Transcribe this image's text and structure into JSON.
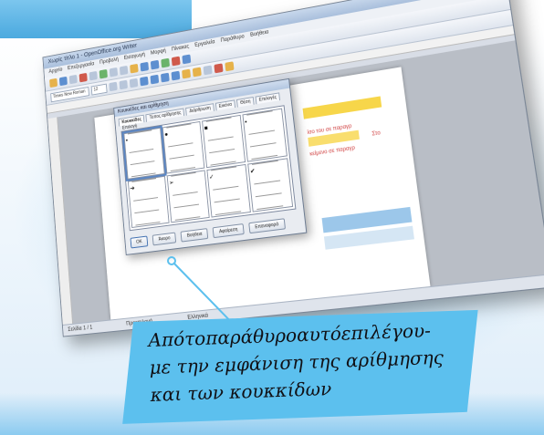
{
  "app": {
    "title": "Χωρίς τίτλο 1 - OpenOffice.org Writer",
    "menu": [
      "Αρχείο",
      "Επεξεργασία",
      "Προβολή",
      "Εισαγωγή",
      "Μορφή",
      "Πίνακας",
      "Εργαλεία",
      "Παράθυρο",
      "Βοήθεια"
    ],
    "font_name": "Times New Roman",
    "font_size": "12",
    "status": [
      "Σελίδα 1 / 1",
      "Προεπιλογή",
      "Ελληνικά"
    ]
  },
  "document": {
    "red_lines": [
      "ίσο του σε παραγρ",
      "Στο",
      "κείμενο σε παραγρ"
    ]
  },
  "dialog": {
    "title": "Κουκκίδες και αρίθμηση",
    "tabs": [
      "Κουκκίδες",
      "Τύπος αρίθμησης",
      "Διάρθρωση",
      "Εικόνα",
      "Θέση",
      "Επιλογές"
    ],
    "group_label": "Επιλογή",
    "bullets": [
      "•",
      "●",
      "■",
      "▪",
      "➔",
      "➢",
      "✓",
      "✔"
    ],
    "buttons": [
      "ΟΚ",
      "Άκυρο",
      "Βοήθεια",
      "Αφαίρεση",
      "Επαναφορά"
    ]
  },
  "callout": {
    "text": "Από το παράθυρο αυτό επιλέγουμε την εμφάνιση της αρίθμησης και των κουκκίδων",
    "line1": "Απότοπαράθυροαυτόεπιλέγου-",
    "line2": "με την εμφάνιση της αρίθμησης",
    "line3": "και των κουκκίδων"
  },
  "colors": {
    "accent": "#5cc0ee",
    "highlight_yellow": "#f7d64a",
    "text_red": "#d04040"
  }
}
